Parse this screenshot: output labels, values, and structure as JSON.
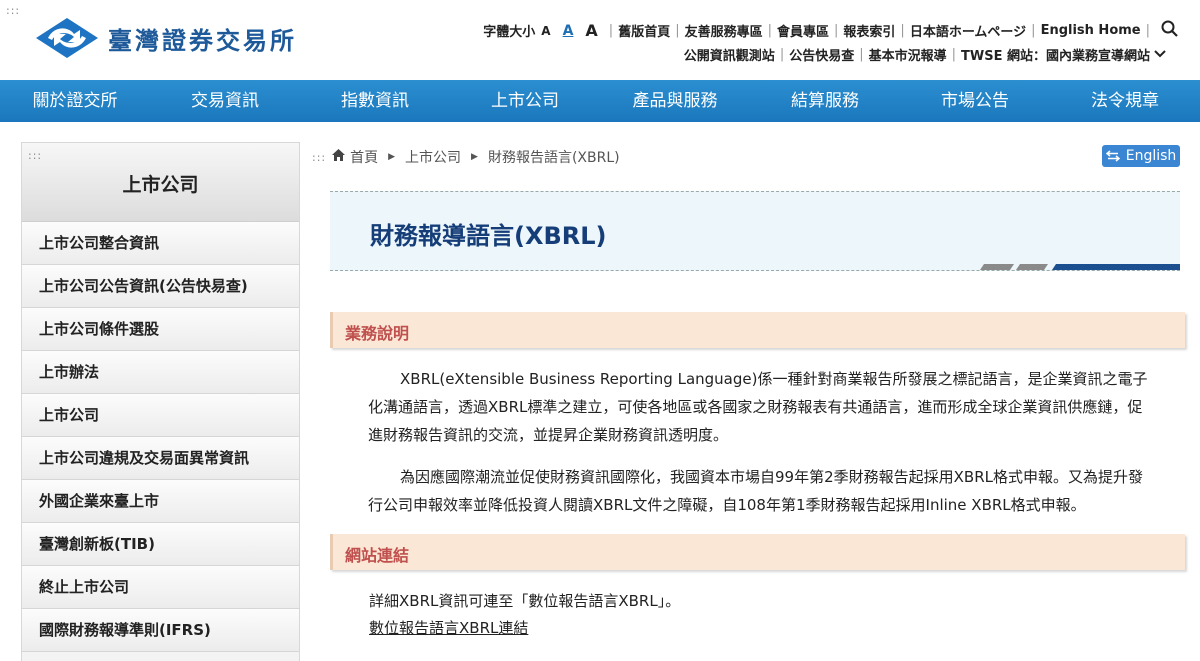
{
  "header": {
    "logo_text": "臺灣證券交易所",
    "accessibility_marker": ":::",
    "font_size_label": "字體大小",
    "font_size_options": [
      "A",
      "A",
      "A"
    ],
    "util_row1": [
      "舊版首頁",
      "友善服務專區",
      "會員專區",
      "報表索引",
      "日本語ホームページ",
      "English Home"
    ],
    "util_row2": [
      "公開資訊觀測站",
      "公告快易查",
      "基本市況報導",
      "TWSE 網站：國內業務宣導網站"
    ]
  },
  "nav": {
    "items": [
      "關於證交所",
      "交易資訊",
      "指數資訊",
      "上市公司",
      "產品與服務",
      "結算服務",
      "市場公告",
      "法令規章"
    ]
  },
  "sidebar": {
    "marker": ":::",
    "title": "上市公司",
    "items": [
      {
        "label": "上市公司整合資訊"
      },
      {
        "label": "上市公司公告資訊(公告快易查)"
      },
      {
        "label": "上市公司條件選股"
      },
      {
        "label": "上市辦法"
      },
      {
        "label": "上市公司"
      },
      {
        "label": "上市公司違規及交易面異常資訊"
      },
      {
        "label": "外國企業來臺上市"
      },
      {
        "label": "臺灣創新板(TIB)"
      },
      {
        "label": "終止上市公司"
      },
      {
        "label": "國際財務報導準則(IFRS)"
      }
    ]
  },
  "breadcrumb": {
    "marker": ":::",
    "home": "首頁",
    "level1": "上市公司",
    "level2": "財務報告語言(XBRL)"
  },
  "english_button": "English",
  "page_title": "財務報導語言(XBRL)",
  "section1": {
    "heading": "業務說明",
    "para1": "XBRL(eXtensible Business Reporting Language)係一種針對商業報告所發展之標記語言，是企業資訊之電子化溝通語言，透過XBRL標準之建立，可使各地區或各國家之財務報表有共通語言，進而形成全球企業資訊供應鏈，促進財務報告資訊的交流，並提昇企業財務資訊透明度。",
    "para2": "為因應國際潮流並促使財務資訊國際化，我國資本市場自99年第2季財務報告起採用XBRL格式申報。又為提升發行公司申報效率並降低投資人閱讀XBRL文件之障礙，自108年第1季財務報告起採用Inline XBRL格式申報。"
  },
  "section2": {
    "heading": "網站連結",
    "text": "詳細XBRL資訊可連至「數位報告語言XBRL」。",
    "link": "數位報告語言XBRL連結"
  },
  "colors": {
    "nav_bg": "#1b77bd",
    "title_text": "#153d78",
    "section_heading": "#c0504d",
    "section_bg": "#fbe7d6",
    "english_btn": "#3a86d3"
  }
}
